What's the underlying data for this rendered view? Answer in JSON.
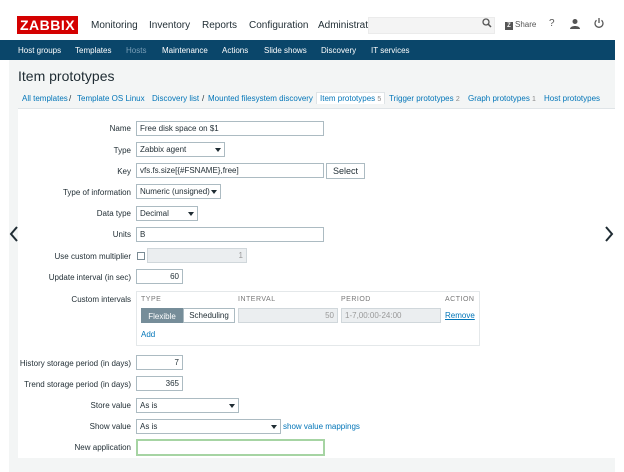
{
  "brand": {
    "logo": "ZABBIX"
  },
  "main_menu": [
    "Monitoring",
    "Inventory",
    "Reports",
    "Configuration",
    "Administratic"
  ],
  "top_actions": {
    "share": "Share",
    "help": "?"
  },
  "sub_menu": [
    "Host groups",
    "Templates",
    "Hosts",
    "Maintenance",
    "Actions",
    "Slide shows",
    "Discovery",
    "IT services"
  ],
  "page": {
    "title": "Item prototypes"
  },
  "breadcrumbs": {
    "all_templates": "All templates",
    "sep": "/",
    "template": "Template OS Linux",
    "discovery_list": "Discovery list",
    "discovery_rule": "Mounted filesystem discovery",
    "tabs": [
      {
        "label": "Item prototypes",
        "count": "5"
      },
      {
        "label": "Trigger prototypes",
        "count": "2"
      },
      {
        "label": "Graph prototypes",
        "count": "1"
      },
      {
        "label": "Host prototypes",
        "count": ""
      }
    ]
  },
  "form": {
    "name": {
      "label": "Name",
      "value": "Free disk space on $1"
    },
    "type": {
      "label": "Type",
      "value": "Zabbix agent"
    },
    "key": {
      "label": "Key",
      "value": "vfs.fs.size[{#FSNAME},free]",
      "select_button": "Select"
    },
    "type_of_information": {
      "label": "Type of information",
      "value": "Numeric (unsigned)"
    },
    "data_type": {
      "label": "Data type",
      "value": "Decimal"
    },
    "units": {
      "label": "Units",
      "value": "B"
    },
    "custom_multiplier": {
      "label": "Use custom multiplier",
      "value": "1"
    },
    "update_interval": {
      "label": "Update interval (in sec)",
      "value": "60"
    },
    "custom_intervals": {
      "label": "Custom intervals",
      "headers": {
        "type": "TYPE",
        "interval": "INTERVAL",
        "period": "PERIOD",
        "action": "ACTION"
      },
      "row": {
        "flexible": "Flexible",
        "scheduling": "Scheduling",
        "interval": "50",
        "period": "1-7,00:00-24:00",
        "remove": "Remove"
      },
      "add": "Add"
    },
    "history": {
      "label": "History storage period (in days)",
      "value": "7"
    },
    "trends": {
      "label": "Trend storage period (in days)",
      "value": "365"
    },
    "store_value": {
      "label": "Store value",
      "value": "As is"
    },
    "show_value": {
      "label": "Show value",
      "value": "As is",
      "mappings_link": "show value mappings"
    },
    "new_application": {
      "label": "New application",
      "value": ""
    }
  },
  "pager": {
    "prev": "‹",
    "next": "›"
  },
  "colors": {
    "logo_red": "#d40000",
    "nav_blue": "#0a466a",
    "link_blue": "#0275b8",
    "focus_green": "#a6d4a3"
  }
}
